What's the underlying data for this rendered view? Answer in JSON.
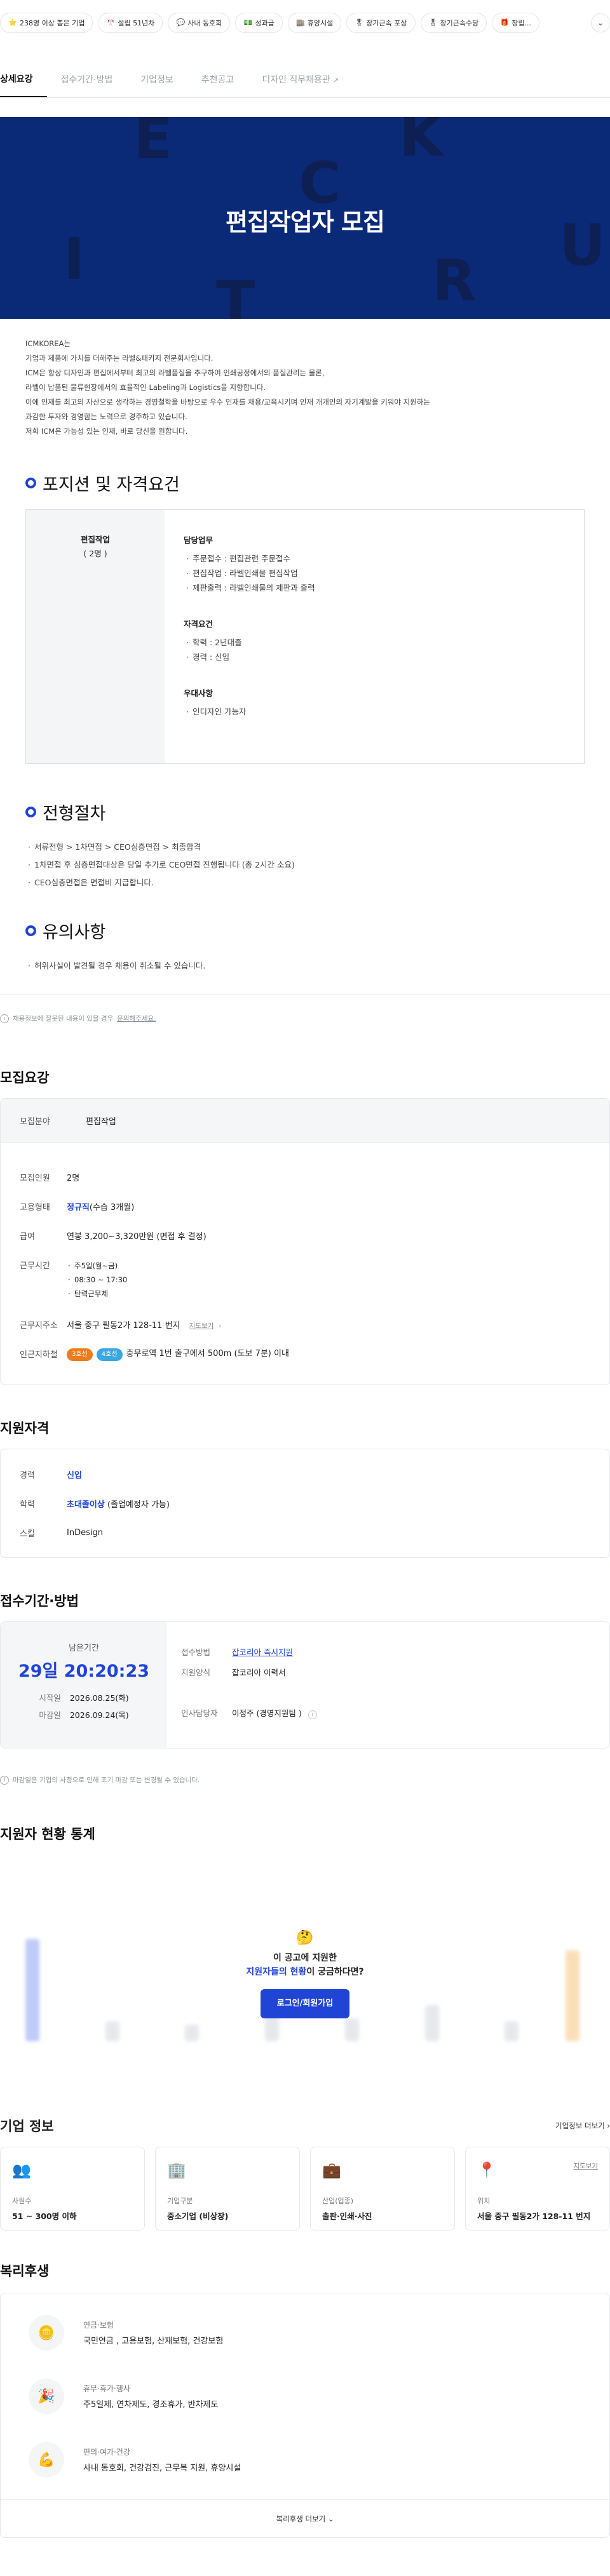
{
  "chips": [
    {
      "icon": "star-icon",
      "glyph": "⭐",
      "label": "238명 이상 뽑은 기업"
    },
    {
      "icon": "pennant-icon",
      "glyph": "🎌",
      "label": "설립 51년차"
    },
    {
      "icon": "chat-icon",
      "glyph": "💬",
      "label": "사내 동호회"
    },
    {
      "icon": "money-icon",
      "glyph": "💵",
      "label": "성과급"
    },
    {
      "icon": "building-icon",
      "glyph": "🏬",
      "label": "휴양시설"
    },
    {
      "icon": "medal-icon",
      "glyph": "🎖",
      "label": "장기근속 포상"
    },
    {
      "icon": "medal-icon",
      "glyph": "🎖",
      "label": "장기근속수당"
    },
    {
      "icon": "gift-icon",
      "glyph": "🎁",
      "label": "창립..."
    }
  ],
  "tabs": [
    "상세요강",
    "접수기간·방법",
    "기업정보",
    "추천공고",
    "디자인 직무채용관"
  ],
  "hero": {
    "title": "편집작업자 모집",
    "deco": [
      "E",
      "K",
      "C",
      "U",
      "I",
      "R",
      "T"
    ]
  },
  "intro": [
    "ICMKOREA는",
    "기업과 제품에 가치를 더해주는 라벨&패키지 전문회사입니다.",
    "ICM은 항상 디자인과 편집에서부터 최고의 라벨품질을 추구하여 인쇄공정에서의 품질관리는 물론,",
    "라벨이 납품된 물류현장에서의 효율적인 Labeling과 Logistics을 지향합니다.",
    "이에 인재를 최고의 자산으로 생각하는 경영철학을 바탕으로 우수 인재를 채용/교육시키며 인재 개개인의 자기계발을 키워야 지원하는",
    "과감한 투자와 경영함는 노력으로 경주하고 있습니다.",
    "저희 ICM은 가능성 있는 인재, 바로 당신을 원합니다."
  ],
  "position": {
    "heading": "포지션 및 자격요건",
    "name": "편집작업",
    "count": "( 2명 )",
    "groups": [
      {
        "title": "담당업무",
        "items": [
          "주문접수 : 편집관련 주문접수",
          "편집작업 : 라벨인쇄물 편집작업",
          "제판출력 : 라벨인쇄물의 제판과 출력"
        ]
      },
      {
        "title": "자격요건",
        "items": [
          "학력 : 2년대졸",
          "경력 : 신입"
        ]
      },
      {
        "title": "우대사항",
        "items": [
          "인디자인 가능자"
        ]
      }
    ]
  },
  "process": {
    "heading": "전형절차",
    "items": [
      "서류전형 > 1차면접 > CEO심층면접 > 최종합격",
      "1차면접 후 심층면접대상은 당일 추가로 CEO면접 진행됩니다 (총 2시간 소요)",
      "CEO심층면접은 면접비 지급합니다."
    ]
  },
  "caution": {
    "heading": "유의사항",
    "items": [
      "허위사실이 발견될 경우 채용이 취소될 수 있습니다."
    ]
  },
  "notice": {
    "text": "채용정보에 잘못된 내용이 있을 경우",
    "link": "문의해주세요."
  },
  "recruit": {
    "title": "모집요강",
    "field_label": "모집분야",
    "field_value": "편집작업",
    "rows": [
      {
        "k": "모집인원",
        "v": "2명"
      },
      {
        "k": "고용형태",
        "v_strong": "정규직",
        "v": "(수습 3개월)"
      },
      {
        "k": "급여",
        "v": "연봉 3,200~3,320만원 (면접 후 결정)"
      }
    ],
    "hours_label": "근무시간",
    "hours": [
      "주5일(월~금)",
      "08:30 ~ 17:30",
      "탄력근무제"
    ],
    "addr_label": "근무지주소",
    "addr": "서울 중구 필동2가 128-11 번지",
    "addr_link": "지도보기",
    "station_label": "인근지하철",
    "lines": [
      {
        "name": "3호선",
        "color": "#ef7c1c"
      },
      {
        "name": "4호선",
        "color": "#3aa7e0"
      }
    ],
    "station": "충무로역 1번 출구에서 500m (도보 7분) 이내"
  },
  "qual": {
    "title": "지원자격",
    "rows": [
      {
        "k": "경력",
        "v": "신입",
        "blue": true
      },
      {
        "k": "학력",
        "v": "초대졸이상",
        "extra": " (졸업예정자 가능)",
        "blue": true
      },
      {
        "k": "스킬",
        "v": "InDesign",
        "blue": false
      }
    ]
  },
  "apply": {
    "title": "접수기간·방법",
    "remain_label": "남은기간",
    "remain": "29일 20:20:23",
    "start_label": "시작일",
    "start": "2026.08.25(화)",
    "end_label": "마감일",
    "end": "2026.09.24(목)",
    "method_label": "접수방법",
    "method": "잡코리아 즉시지원",
    "form_label": "지원양식",
    "form": "잡코리아 이력서",
    "hr_label": "인사담당자",
    "hr": "이정주 (경영지원팀 )",
    "note": "마감일은 기업의 사정으로 인해 조기 마감 또는 변경될 수 있습니다."
  },
  "stats": {
    "title": "지원자 현황 통계",
    "q1": "이 공고에 지원한",
    "q2_strong": "지원자들의 현황",
    "q2": "이 궁금하다면?",
    "button": "로그인/회원가입",
    "blur_bars": [
      0.62,
      0.12,
      0.1,
      0.18,
      0.14,
      0.22,
      0.12,
      0.55
    ]
  },
  "company": {
    "title": "기업 정보",
    "more": "기업정보 더보기",
    "cards": [
      {
        "icon": "people-icon",
        "glyph": "👥",
        "label": "사원수",
        "value": "51 ~ 300명 이하"
      },
      {
        "icon": "office-icon",
        "glyph": "🏢",
        "label": "기업구분",
        "value": "중소기업 (비상장)"
      },
      {
        "icon": "briefcase-icon",
        "glyph": "💼",
        "label": "산업(업종)",
        "value": "출판·인쇄·사진"
      },
      {
        "icon": "location-icon",
        "glyph": "📍",
        "label": "위치",
        "value": "서울 중구 필동2가 128-11 번지",
        "link": "지도보기"
      }
    ]
  },
  "welfare": {
    "title": "복리후생",
    "rows": [
      {
        "icon": "pension-icon",
        "glyph": "🪙",
        "label": "연금·보험",
        "value": "국민연금 , 고용보험, 산재보험, 건강보험"
      },
      {
        "icon": "party-icon",
        "glyph": "🎉",
        "label": "휴무·휴가·행사",
        "value": "주5일제, 연차제도, 경조휴가, 반차제도"
      },
      {
        "icon": "muscle-icon",
        "glyph": "💪",
        "label": "편의·여가·건강",
        "value": "사내 동호회, 건강검진, 근무복 지원, 휴양시설"
      }
    ],
    "more": "복리후생 더보기"
  }
}
